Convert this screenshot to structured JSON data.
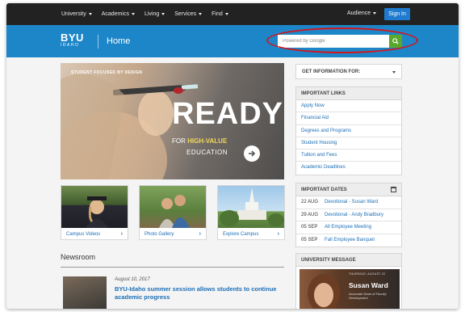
{
  "nav": {
    "items": [
      {
        "label": "University"
      },
      {
        "label": "Academics"
      },
      {
        "label": "Living"
      },
      {
        "label": "Services"
      },
      {
        "label": "Find"
      }
    ],
    "audience": "Audience",
    "sign_in": "Sign In"
  },
  "header": {
    "logo_main": "BYU",
    "logo_sub": "IDAHO",
    "title": "Home",
    "search_placeholder": "Powered by Google"
  },
  "hero": {
    "tagline": "STUDENT FOCUSED BY DESIGN",
    "headline": "READY",
    "line2_prefix": "FOR ",
    "line2_highlight": "HIGH-VALUE",
    "line3": "EDUCATION"
  },
  "cards": [
    {
      "label": "Campus Videos"
    },
    {
      "label": "Photo Gallery"
    },
    {
      "label": "Explore Campus"
    }
  ],
  "newsroom": {
    "title": "Newsroom",
    "date": "August 10, 2017",
    "headline": "BYU-Idaho summer session allows students to continue academic progress"
  },
  "sidebar": {
    "get_info": "GET INFORMATION FOR:",
    "links_title": "IMPORTANT LINKS",
    "links": [
      {
        "label": "Apply Now"
      },
      {
        "label": "Financial Aid"
      },
      {
        "label": "Degrees and Programs"
      },
      {
        "label": "Student Housing"
      },
      {
        "label": "Tuition and Fees"
      },
      {
        "label": "Academic Deadlines"
      }
    ],
    "dates_title": "IMPORTANT DATES",
    "dates": [
      {
        "date": "22 AUG",
        "title": "Devotional - Susan Ward"
      },
      {
        "date": "29 AUG",
        "title": "Devotional - Andy Bradbury"
      },
      {
        "date": "05 SEP",
        "title": "All Employee Meeting"
      },
      {
        "date": "05 SEP",
        "title": "Fall Employee Banquet"
      }
    ],
    "message_title": "UNIVERSITY MESSAGE",
    "message_day": "THURSDAY, AUGUST 22",
    "message_name": "Susan Ward",
    "message_role": "Associate Dean of Faculty Development"
  },
  "colors": {
    "topnav": "#222222",
    "header_blue": "#1c86c8",
    "sign_in_blue": "#1e7bd0",
    "search_green": "#5aa72a",
    "link_blue": "#1c6fb7",
    "highlight_red": "#d4161c"
  }
}
